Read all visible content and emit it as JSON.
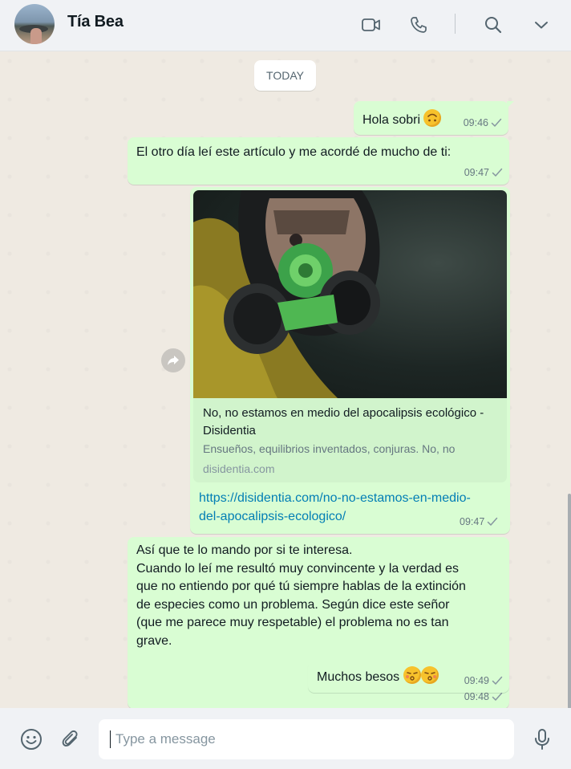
{
  "header": {
    "contact_name": "Tía Bea",
    "icons": [
      "video-call-icon",
      "voice-call-icon",
      "search-icon",
      "chevron-down-icon"
    ]
  },
  "chat": {
    "date_label": "TODAY",
    "messages": [
      {
        "text": "Hola sobri",
        "emoji": "upside-down-face",
        "time": "09:46",
        "status": "sent"
      },
      {
        "text": "El otro día leí este artículo y me acordé de mucho de ti:",
        "time": "09:47",
        "status": "sent"
      },
      {
        "link_preview": {
          "title": "No, no estamos en medio del apocalipsis ecológico - Disidentia",
          "description": "Ensueños, equilibrios inventados, conjuras. No, no",
          "domain": "disidentia.com"
        },
        "url": "https://disidentia.com/no-no-estamos-en-medio-del-apocalipsis-ecologico/",
        "time": "09:47",
        "status": "sent"
      },
      {
        "lines": [
          "Así que te lo mando por si te interesa.",
          "Cuando lo leí me resultó muy convincente y la verdad es",
          "que no entiendo por qué tú siempre hablas de la extinción",
          "de especies como un problema. Según dice este señor",
          "(que me parece muy respetable) el problema no es tan",
          "grave."
        ],
        "time": "09:48",
        "status": "sent"
      },
      {
        "text": "Muchos besos",
        "emoji": "kissing-face-x2",
        "time": "09:49",
        "status": "sent"
      }
    ]
  },
  "composer": {
    "placeholder": "Type a message",
    "icons": [
      "emoji-icon",
      "attach-icon",
      "microphone-icon"
    ]
  },
  "colors": {
    "outgoing_bubble": "#d9fdd3",
    "background": "#efeae2",
    "link": "#027eb5",
    "meta_text": "#667781"
  }
}
